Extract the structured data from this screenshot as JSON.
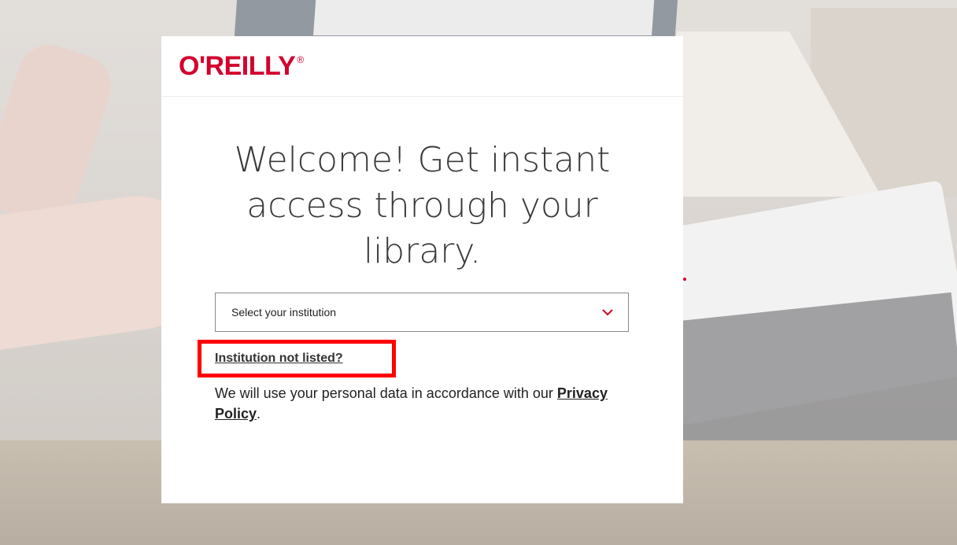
{
  "brand": {
    "logo_text": "O'REILLY",
    "registered_mark": "®",
    "accent_color": "#d3002d"
  },
  "headline": "Welcome! Get instant access through your library.",
  "institution_select": {
    "selected_text": "Select your institution",
    "icon": "chevron-down-icon"
  },
  "not_listed_link": "Institution not listed?",
  "privacy": {
    "prefix": "We will use your personal data in accordance with our",
    "link_text": "Privacy Policy",
    "suffix": "."
  },
  "highlight_color": "#ff0000"
}
